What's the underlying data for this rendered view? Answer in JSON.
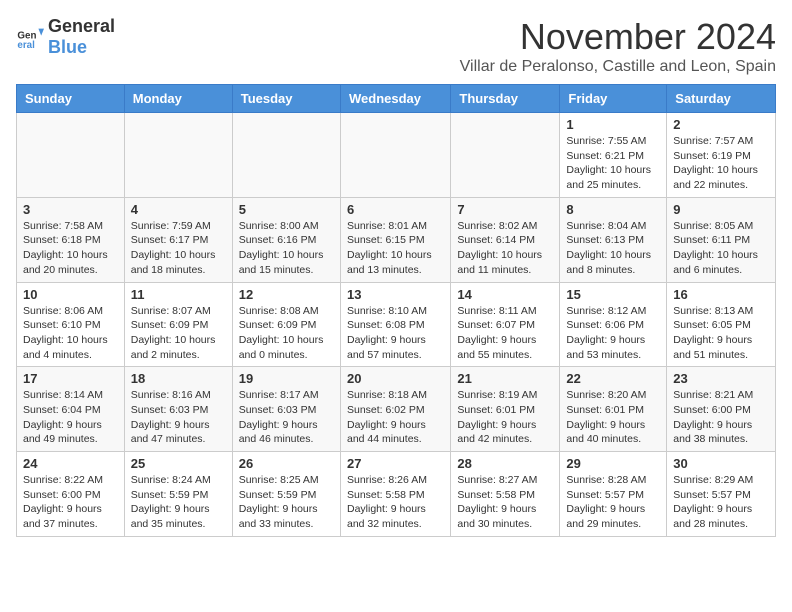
{
  "logo": {
    "text_general": "General",
    "text_blue": "Blue"
  },
  "title": "November 2024",
  "subtitle": "Villar de Peralonso, Castille and Leon, Spain",
  "days_of_week": [
    "Sunday",
    "Monday",
    "Tuesday",
    "Wednesday",
    "Thursday",
    "Friday",
    "Saturday"
  ],
  "weeks": [
    [
      {
        "day": "",
        "info": ""
      },
      {
        "day": "",
        "info": ""
      },
      {
        "day": "",
        "info": ""
      },
      {
        "day": "",
        "info": ""
      },
      {
        "day": "",
        "info": ""
      },
      {
        "day": "1",
        "info": "Sunrise: 7:55 AM\nSunset: 6:21 PM\nDaylight: 10 hours and 25 minutes."
      },
      {
        "day": "2",
        "info": "Sunrise: 7:57 AM\nSunset: 6:19 PM\nDaylight: 10 hours and 22 minutes."
      }
    ],
    [
      {
        "day": "3",
        "info": "Sunrise: 7:58 AM\nSunset: 6:18 PM\nDaylight: 10 hours and 20 minutes."
      },
      {
        "day": "4",
        "info": "Sunrise: 7:59 AM\nSunset: 6:17 PM\nDaylight: 10 hours and 18 minutes."
      },
      {
        "day": "5",
        "info": "Sunrise: 8:00 AM\nSunset: 6:16 PM\nDaylight: 10 hours and 15 minutes."
      },
      {
        "day": "6",
        "info": "Sunrise: 8:01 AM\nSunset: 6:15 PM\nDaylight: 10 hours and 13 minutes."
      },
      {
        "day": "7",
        "info": "Sunrise: 8:02 AM\nSunset: 6:14 PM\nDaylight: 10 hours and 11 minutes."
      },
      {
        "day": "8",
        "info": "Sunrise: 8:04 AM\nSunset: 6:13 PM\nDaylight: 10 hours and 8 minutes."
      },
      {
        "day": "9",
        "info": "Sunrise: 8:05 AM\nSunset: 6:11 PM\nDaylight: 10 hours and 6 minutes."
      }
    ],
    [
      {
        "day": "10",
        "info": "Sunrise: 8:06 AM\nSunset: 6:10 PM\nDaylight: 10 hours and 4 minutes."
      },
      {
        "day": "11",
        "info": "Sunrise: 8:07 AM\nSunset: 6:09 PM\nDaylight: 10 hours and 2 minutes."
      },
      {
        "day": "12",
        "info": "Sunrise: 8:08 AM\nSunset: 6:09 PM\nDaylight: 10 hours and 0 minutes."
      },
      {
        "day": "13",
        "info": "Sunrise: 8:10 AM\nSunset: 6:08 PM\nDaylight: 9 hours and 57 minutes."
      },
      {
        "day": "14",
        "info": "Sunrise: 8:11 AM\nSunset: 6:07 PM\nDaylight: 9 hours and 55 minutes."
      },
      {
        "day": "15",
        "info": "Sunrise: 8:12 AM\nSunset: 6:06 PM\nDaylight: 9 hours and 53 minutes."
      },
      {
        "day": "16",
        "info": "Sunrise: 8:13 AM\nSunset: 6:05 PM\nDaylight: 9 hours and 51 minutes."
      }
    ],
    [
      {
        "day": "17",
        "info": "Sunrise: 8:14 AM\nSunset: 6:04 PM\nDaylight: 9 hours and 49 minutes."
      },
      {
        "day": "18",
        "info": "Sunrise: 8:16 AM\nSunset: 6:03 PM\nDaylight: 9 hours and 47 minutes."
      },
      {
        "day": "19",
        "info": "Sunrise: 8:17 AM\nSunset: 6:03 PM\nDaylight: 9 hours and 46 minutes."
      },
      {
        "day": "20",
        "info": "Sunrise: 8:18 AM\nSunset: 6:02 PM\nDaylight: 9 hours and 44 minutes."
      },
      {
        "day": "21",
        "info": "Sunrise: 8:19 AM\nSunset: 6:01 PM\nDaylight: 9 hours and 42 minutes."
      },
      {
        "day": "22",
        "info": "Sunrise: 8:20 AM\nSunset: 6:01 PM\nDaylight: 9 hours and 40 minutes."
      },
      {
        "day": "23",
        "info": "Sunrise: 8:21 AM\nSunset: 6:00 PM\nDaylight: 9 hours and 38 minutes."
      }
    ],
    [
      {
        "day": "24",
        "info": "Sunrise: 8:22 AM\nSunset: 6:00 PM\nDaylight: 9 hours and 37 minutes."
      },
      {
        "day": "25",
        "info": "Sunrise: 8:24 AM\nSunset: 5:59 PM\nDaylight: 9 hours and 35 minutes."
      },
      {
        "day": "26",
        "info": "Sunrise: 8:25 AM\nSunset: 5:59 PM\nDaylight: 9 hours and 33 minutes."
      },
      {
        "day": "27",
        "info": "Sunrise: 8:26 AM\nSunset: 5:58 PM\nDaylight: 9 hours and 32 minutes."
      },
      {
        "day": "28",
        "info": "Sunrise: 8:27 AM\nSunset: 5:58 PM\nDaylight: 9 hours and 30 minutes."
      },
      {
        "day": "29",
        "info": "Sunrise: 8:28 AM\nSunset: 5:57 PM\nDaylight: 9 hours and 29 minutes."
      },
      {
        "day": "30",
        "info": "Sunrise: 8:29 AM\nSunset: 5:57 PM\nDaylight: 9 hours and 28 minutes."
      }
    ]
  ]
}
